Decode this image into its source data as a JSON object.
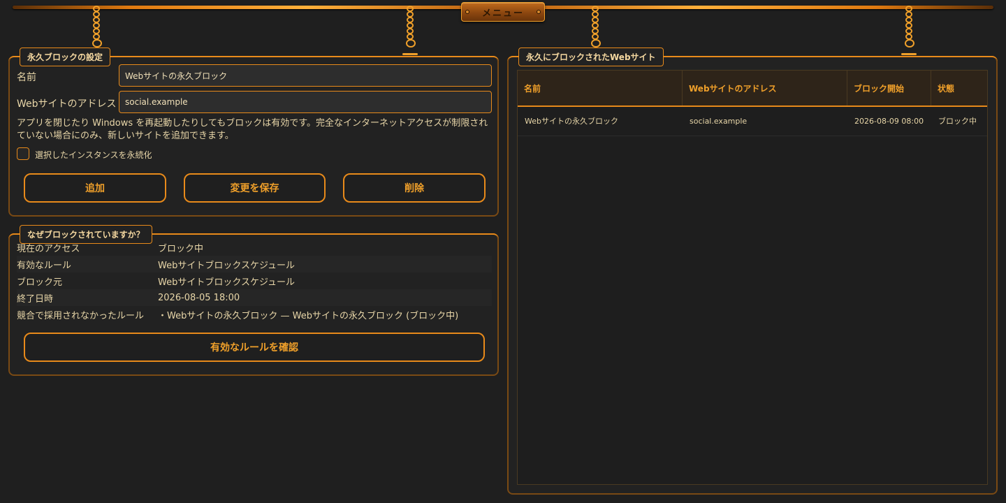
{
  "menu": {
    "label": "メニュー"
  },
  "settings": {
    "legend": "永久ブロックの設定",
    "name_label": "名前",
    "name_value": "Webサイトの永久ブロック",
    "address_label": "Webサイトのアドレス",
    "address_value": "social.example",
    "note": "アプリを閉じたり Windows を再起動したりしてもブロックは有効です。完全なインターネットアクセスが制限されていない場合にのみ、新しいサイトを追加できます。",
    "checkbox_label": "選択したインスタンスを永続化",
    "add_label": "追加",
    "save_label": "変更を保存",
    "delete_label": "削除"
  },
  "why": {
    "legend": "なぜブロックされていますか？",
    "rows": [
      {
        "key": "現在のアクセス",
        "value": "ブロック中"
      },
      {
        "key": "有効なルール",
        "value": "Webサイトブロックスケジュール"
      },
      {
        "key": "ブロック元",
        "value": "Webサイトブロックスケジュール"
      },
      {
        "key": "終了日時",
        "value": "2026-08-05 18:00"
      },
      {
        "key": "競合で採用されなかったルール",
        "value": "・Webサイトの永久ブロック — Webサイトの永久ブロック (ブロック中)"
      }
    ],
    "check_button": "有効なルールを確認"
  },
  "blocked_sites": {
    "legend": "永久にブロックされたWebサイト",
    "columns": [
      "名前",
      "Webサイトのアドレス",
      "ブロック開始",
      "状態"
    ],
    "rows": [
      {
        "name": "Webサイトの永久ブロック",
        "address": "social.example",
        "start": "2026-08-09 08:00",
        "status": "ブロック中"
      }
    ]
  },
  "colors": {
    "accent": "#e88a1a",
    "background": "#1f1f1f",
    "text": "#e8d6a8",
    "header_bg": "#2e2419"
  }
}
